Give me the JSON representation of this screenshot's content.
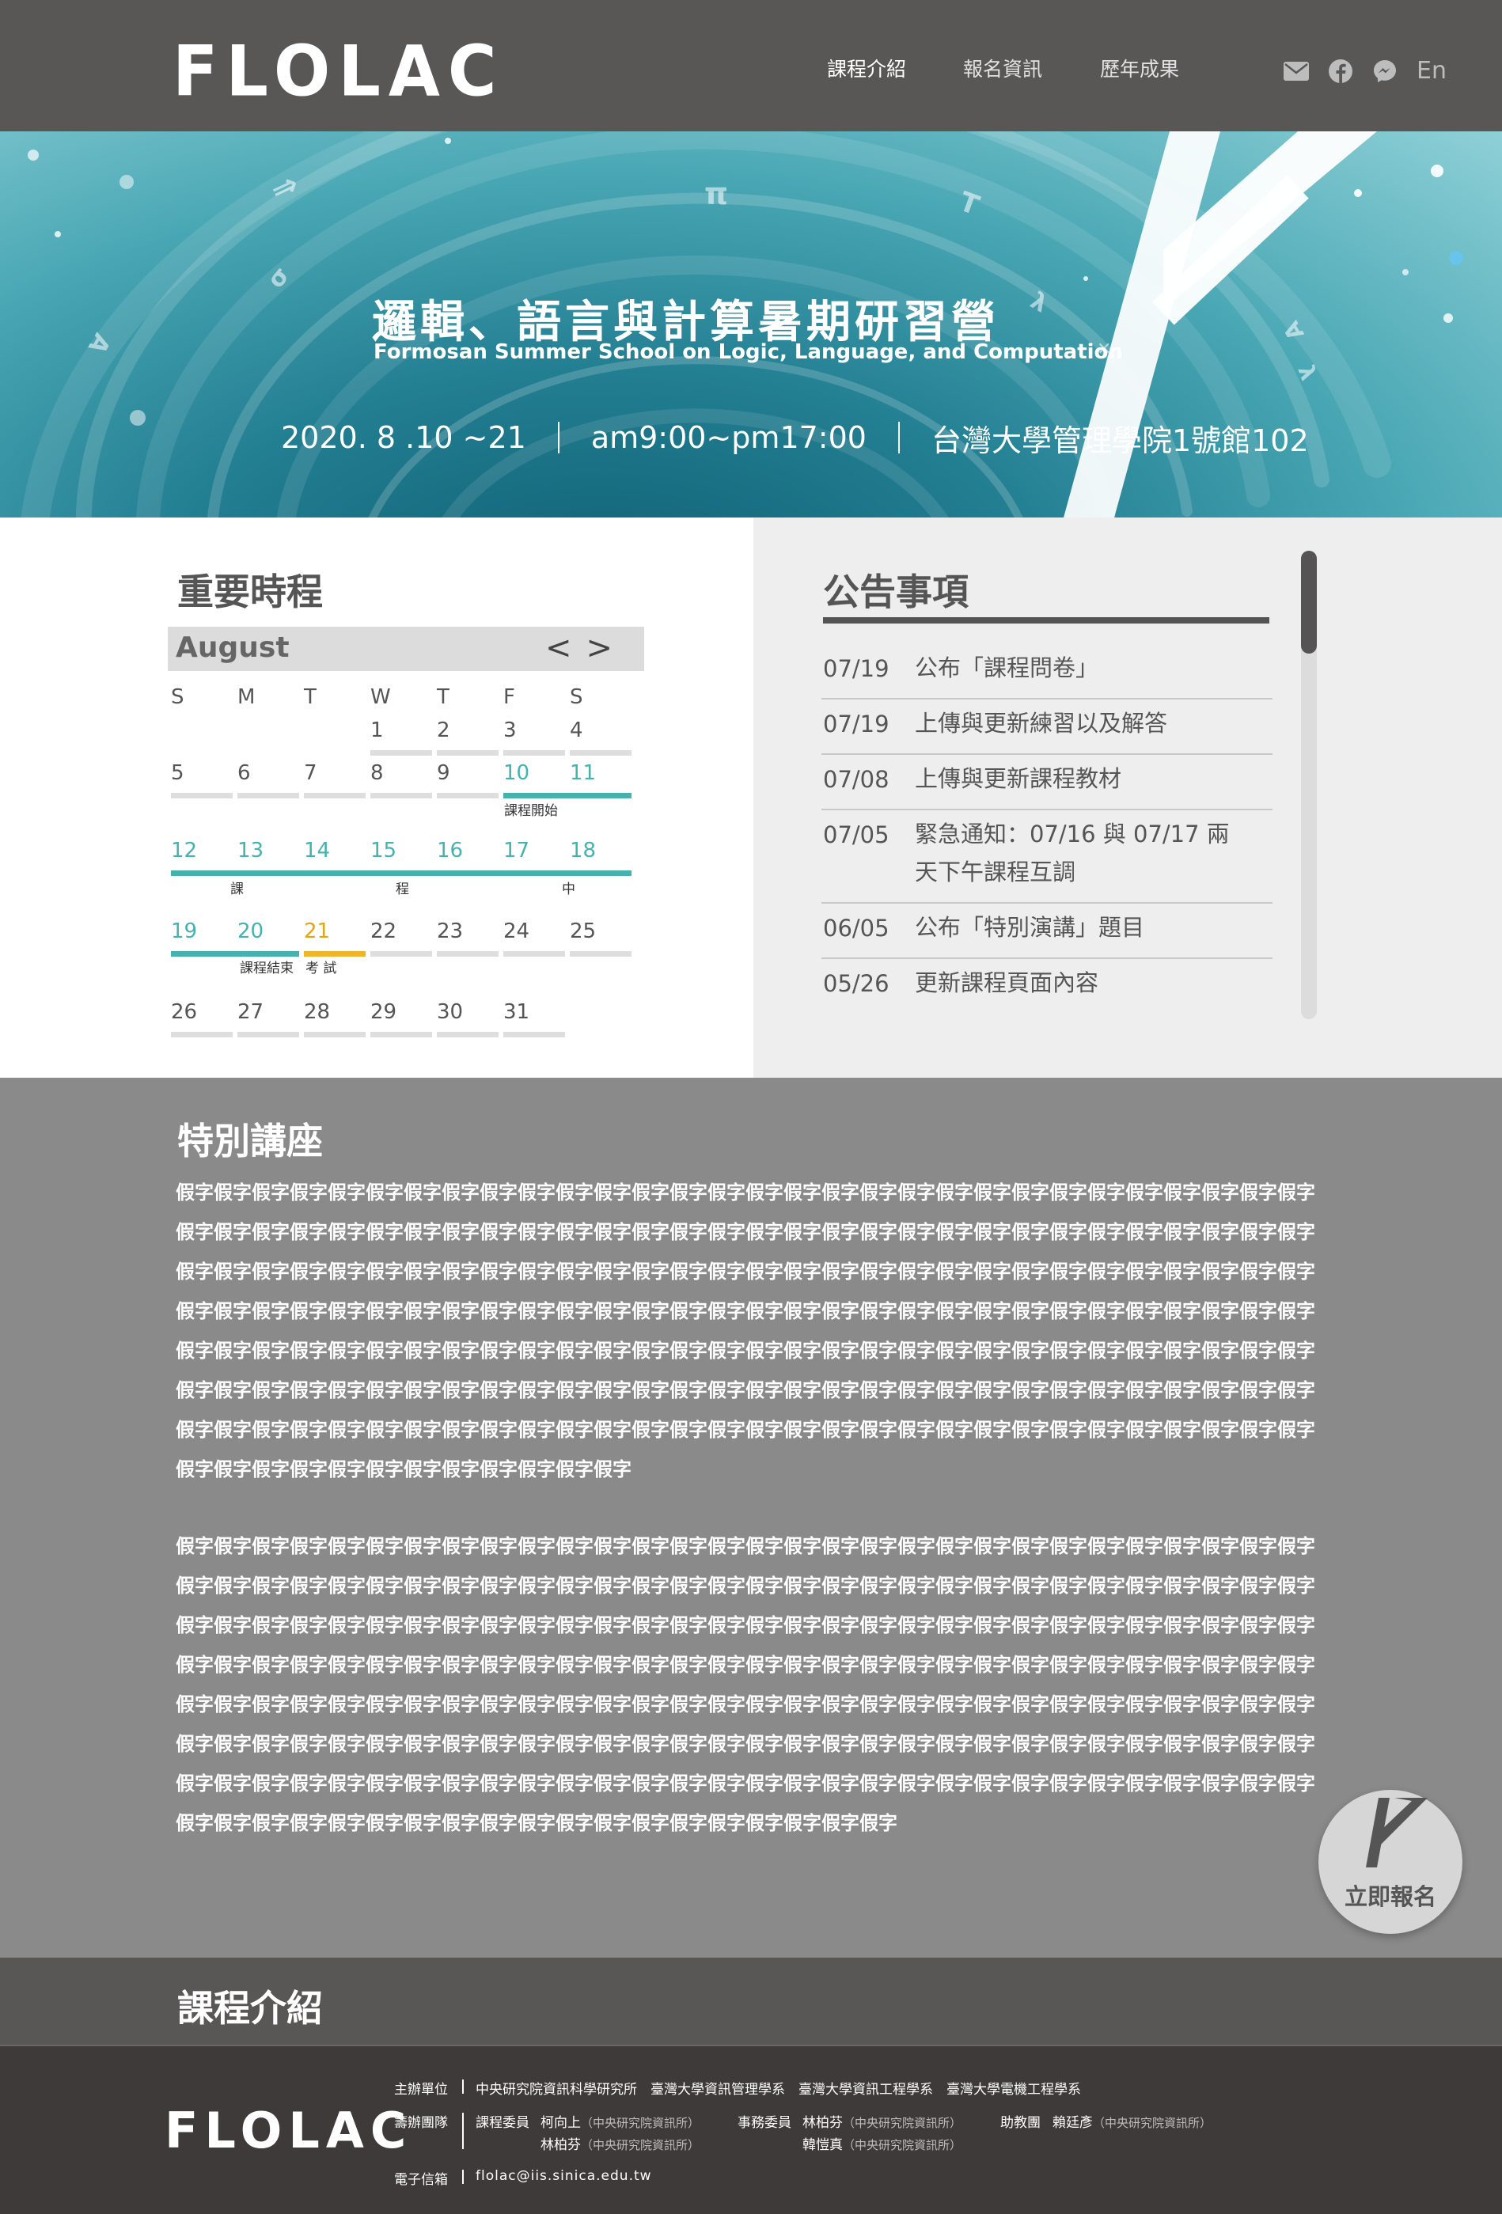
{
  "header": {
    "logo": "FLOLAC",
    "nav": [
      "課程介紹",
      "報名資訊",
      "歷年成果"
    ],
    "icons": [
      "mail-icon",
      "facebook-icon",
      "messenger-icon"
    ],
    "lang": "En"
  },
  "banner": {
    "title": "邏輯、語言與計算暑期研習營",
    "subtitle": "Formosan Summer School on Logic, Language, and Computation",
    "date": "2020. 8 .10 ~21",
    "time": "am9:00~pm17:00",
    "venue": "台灣大學管理學院1號館102"
  },
  "schedule": {
    "title": "重要時程",
    "month": "August",
    "prev": "<",
    "next": ">",
    "weekdays": [
      "S",
      "M",
      "T",
      "W",
      "T",
      "F",
      "S"
    ],
    "weeks": [
      [
        "",
        "",
        "",
        "1",
        "2",
        "3",
        "4"
      ],
      [
        "5",
        "6",
        "7",
        "8",
        "9",
        "10",
        "11"
      ],
      [
        "12",
        "13",
        "14",
        "15",
        "16",
        "17",
        "18"
      ],
      [
        "19",
        "20",
        "21",
        "22",
        "23",
        "24",
        "25"
      ],
      [
        "26",
        "27",
        "28",
        "29",
        "30",
        "31",
        ""
      ]
    ],
    "notes": {
      "course_start": "課程開始",
      "course_chars": [
        "課",
        "程",
        "中"
      ],
      "course_end": "課程結束",
      "exam": "考 試"
    }
  },
  "announcements": {
    "title": "公告事項",
    "items": [
      {
        "date": "07/19",
        "text": "公布「課程問卷」"
      },
      {
        "date": "07/19",
        "text": "上傳與更新練習以及解答"
      },
      {
        "date": "07/08",
        "text": "上傳與更新課程教材"
      },
      {
        "date": "07/05",
        "text": "緊急通知：07/16 與 07/17 兩天下午課程互調"
      },
      {
        "date": "06/05",
        "text": "公布「特別演講」題目"
      },
      {
        "date": "05/26",
        "text": "更新課程頁面內容"
      }
    ]
  },
  "lecture": {
    "title": "特別講座",
    "paragraph1": "假字假字假字假字假字假字假字假字假字假字假字假字假字假字假字假字假字假字假字假字假字假字假字假字假字假字假字假字假字假字假字假字假字假字假字假字假字假字假字假字假字假字假字假字假字假字假字假字假字假字假字假字假字假字假字假字假字假字假字假字假字假字假字假字假字假字假字假字假字假字假字假字假字假字假字假字假字假字假字假字假字假字假字假字假字假字假字假字假字假字假字假字假字假字假字假字假字假字假字假字假字假字假字假字假字假字假字假字假字假字假字假字假字假字假字假字假字假字假字假字假字假字假字假字假字假字假字假字假字假字假字假字假字假字假字假字假字假字假字假字假字假字假字假字假字假字假字假字假字假字假字假字假字假字假字假字假字假字假字假字假字假字假字假字假字假字假字假字假字假字假字假字假字假字假字假字假字假字假字假字假字假字假字假字假字假字假字假字假字假字假字假字假字假字假字假字假字假字假字假字假字假字假字假字假字假字假字假字假字假字假字假字假字假字假字假字假字假字假字假字假字假字",
    "paragraph2": "假字假字假字假字假字假字假字假字假字假字假字假字假字假字假字假字假字假字假字假字假字假字假字假字假字假字假字假字假字假字假字假字假字假字假字假字假字假字假字假字假字假字假字假字假字假字假字假字假字假字假字假字假字假字假字假字假字假字假字假字假字假字假字假字假字假字假字假字假字假字假字假字假字假字假字假字假字假字假字假字假字假字假字假字假字假字假字假字假字假字假字假字假字假字假字假字假字假字假字假字假字假字假字假字假字假字假字假字假字假字假字假字假字假字假字假字假字假字假字假字假字假字假字假字假字假字假字假字假字假字假字假字假字假字假字假字假字假字假字假字假字假字假字假字假字假字假字假字假字假字假字假字假字假字假字假字假字假字假字假字假字假字假字假字假字假字假字假字假字假字假字假字假字假字假字假字假字假字假字假字假字假字假字假字假字假字假字假字假字假字假字假字假字假字假字假字假字假字假字假字假字假字假字假字假字假字假字假字假字假字假字假字假字假字假字假字假字假字假字假字假字假字假字假字假字假字假字假字假字",
    "signup": "立即報名"
  },
  "course": {
    "title": "課程介紹"
  },
  "footer": {
    "logo": "FLOLAC",
    "organizer_label": "主辦單位",
    "organizers": "中央研究院資訊科學研究所　臺灣大學資訊管理學系　臺灣大學資訊工程學系　臺灣大學電機工程學系",
    "team_label": "籌辦團隊",
    "committee_label": "課程委員",
    "committee_1": "柯向上",
    "committee_1_aff": "（中央研究院資訊所）",
    "committee_2": "林柏芬",
    "committee_2_aff": "（中央研究院資訊所）",
    "affairs_label": "事務委員",
    "affairs_1": "林柏芬",
    "affairs_1_aff": "（中央研究院資訊所）",
    "affairs_2": "韓愷真",
    "affairs_2_aff": "（中央研究院資訊所）",
    "ta_label": "助教團",
    "ta_1": "賴廷彥",
    "ta_1_aff": "（中央研究院資訊所）",
    "email_label": "電子信箱",
    "email": "flolac@iis.sinica.edu.tw"
  }
}
